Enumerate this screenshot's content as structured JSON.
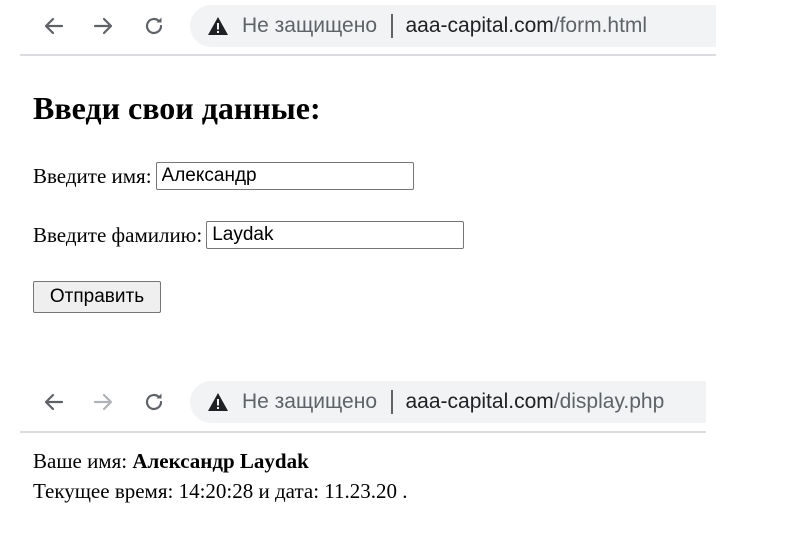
{
  "browser_top": {
    "security_label": "Не защищено",
    "url_host": "aaa-capital.com",
    "url_path": "/form.html"
  },
  "form": {
    "heading": "Введи свои данные:",
    "first_name_label": "Введите имя:",
    "first_name_value": "Александр",
    "last_name_label": "Введите фамилию:",
    "last_name_value": "Laydak",
    "submit_label": "Отправить"
  },
  "browser_bottom": {
    "security_label": "Не защищено",
    "url_host": "aaa-capital.com",
    "url_path": "/display.php"
  },
  "display": {
    "name_label": "Ваше имя:",
    "name_value": "Александр Laydak",
    "time_line": "Текущее время: 14:20:28 и дата: 11.23.20 ."
  },
  "icons": {
    "back": "back-arrow-icon",
    "forward": "forward-arrow-icon",
    "reload": "reload-icon",
    "warning": "warning-triangle-icon"
  },
  "colors": {
    "icon_active": "#5f6368",
    "icon_disabled": "#b0b3b7",
    "omnibox_bg": "#f1f3f4",
    "security_text": "#5f6368",
    "url_host": "#202124"
  }
}
